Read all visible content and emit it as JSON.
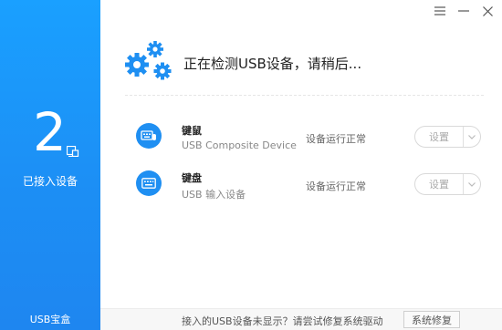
{
  "sidebar": {
    "device_count": "2",
    "connected_label": "已接入设备",
    "app_name": "USB宝盒"
  },
  "header": {
    "detect_text": "正在检测USB设备，请稍后..."
  },
  "devices": [
    {
      "name": "键鼠",
      "subtitle": "USB Composite Device",
      "status": "设备运行正常",
      "settings_label": "设置",
      "icon": "keyboard-mouse-icon"
    },
    {
      "name": "键盘",
      "subtitle": "USB 输入设备",
      "status": "设备运行正常",
      "settings_label": "设置",
      "icon": "keyboard-icon"
    }
  ],
  "footer": {
    "hint": "接入的USB设备未显示？请尝试修复系统驱动",
    "repair_label": "系统修复"
  },
  "colors": {
    "accent": "#1e8ff2",
    "sidebar": "#1a9bff"
  }
}
